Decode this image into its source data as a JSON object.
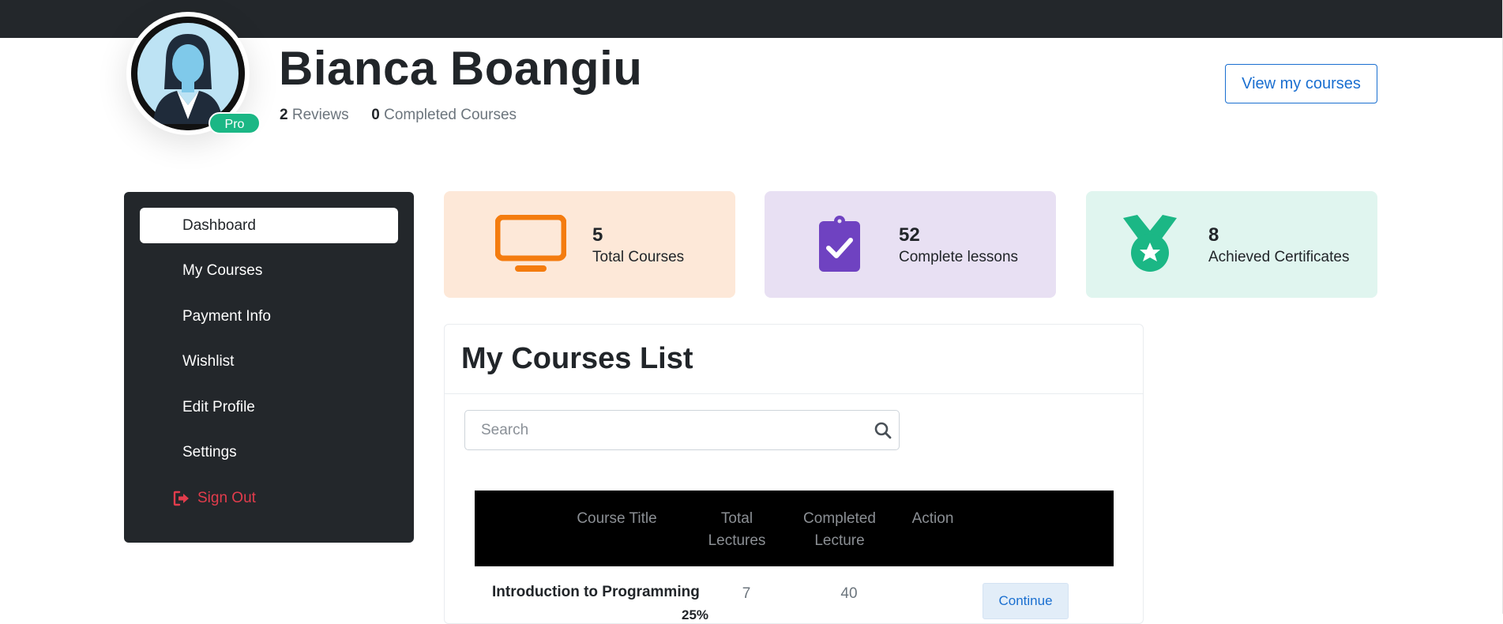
{
  "profile": {
    "name": "Bianca Boangiu",
    "badge": "Pro",
    "reviews_count": "2",
    "reviews_label": "Reviews",
    "completed_count": "0",
    "completed_label": "Completed Courses",
    "view_courses_label": "View my courses"
  },
  "sidebar": {
    "items": [
      {
        "label": "Dashboard",
        "active": true
      },
      {
        "label": "My Courses"
      },
      {
        "label": "Payment Info"
      },
      {
        "label": "Wishlist"
      },
      {
        "label": "Edit Profile"
      },
      {
        "label": "Settings"
      },
      {
        "label": "Sign Out",
        "icon": "sign-out-icon"
      }
    ]
  },
  "stats": [
    {
      "value": "5",
      "label": "Total Courses",
      "icon": "monitor-icon",
      "bg": "#fde8d8",
      "accent": "#f47c0f"
    },
    {
      "value": "52",
      "label": "Complete lessons",
      "icon": "clipboard-check-icon",
      "bg": "#e8e0f3",
      "accent": "#6f42c1"
    },
    {
      "value": "8",
      "label": "Achieved Certificates",
      "icon": "medal-icon",
      "bg": "#e0f5ef",
      "accent": "#1bb785"
    }
  ],
  "courses": {
    "title": "My Courses List",
    "search_placeholder": "Search",
    "headers": {
      "title": "Course Title",
      "total_line1": "Total",
      "total_line2": "Lectures",
      "completed_line1": "Completed",
      "completed_line2": "Lecture",
      "action": "Action"
    },
    "rows": [
      {
        "title": "Introduction to Programming",
        "total": "7",
        "completed": "40",
        "action": "Continue",
        "percent": "25%"
      }
    ]
  },
  "colors": {
    "topbar": "#23272b",
    "sidebar": "#23272b",
    "brand_blue": "#1a6fd0",
    "danger": "#e23c4c",
    "badge_green": "#1bb785"
  }
}
